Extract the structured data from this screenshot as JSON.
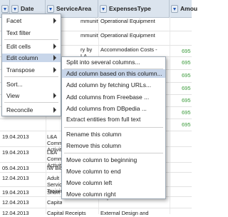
{
  "header": {
    "date": "Date",
    "service_area": "ServiceArea",
    "expenses_type": "ExpensesType",
    "amount": "Amou"
  },
  "rows": [
    {
      "date": "",
      "service": "mmunity",
      "expense": "Operational Equipment",
      "amount": ""
    },
    {
      "date": "",
      "service": "mmunity",
      "expense": "Operational Equipment",
      "amount": ""
    },
    {
      "date": "",
      "service": "ry by LA",
      "expense": "Accommodation Costs -",
      "amount": "695"
    },
    {
      "date": "",
      "service": "",
      "expense": "",
      "amount": "695"
    },
    {
      "date": "",
      "service": "",
      "expense": "",
      "amount": "695"
    },
    {
      "date": "",
      "service": "",
      "expense": "",
      "amount": "695"
    },
    {
      "date": "",
      "service": "",
      "expense": "",
      "amount": "695"
    },
    {
      "date": "",
      "service": "",
      "expense": "",
      "amount": "695"
    },
    {
      "date": "",
      "service": "",
      "expense": "",
      "amount": "695"
    },
    {
      "date": "19.04.2013",
      "service": "L&A Comm Activity",
      "expense": "",
      "amount": ""
    },
    {
      "date": "19.04.2013",
      "service": "L&A Comm Activity",
      "expense": "",
      "amount": ""
    },
    {
      "date": "05.04.2013",
      "service": "IW Biologica",
      "expense": "",
      "amount": ""
    },
    {
      "date": "12.04.2013",
      "service": "Adult Servic Training",
      "expense": "",
      "amount": ""
    },
    {
      "date": "19.04.2013",
      "service": "Short Break",
      "expense": "",
      "amount": ""
    },
    {
      "date": "12.04.2013",
      "service": "Capital Rec",
      "expense": "",
      "amount": ""
    },
    {
      "date": "12.04.2013",
      "service": "Capital Receipts",
      "expense": "External Design and",
      "amount": ""
    }
  ],
  "partial_texts": {
    "supervision": "Supervision Fees"
  },
  "main_menu": [
    {
      "label": "Facet",
      "submenu": true
    },
    {
      "label": "Text filter",
      "submenu": false
    },
    {
      "label": "Edit cells",
      "submenu": true
    },
    {
      "label": "Edit column",
      "submenu": true,
      "highlight": true
    },
    {
      "label": "Transpose",
      "submenu": true
    },
    {
      "label": "Sort...",
      "submenu": false
    },
    {
      "label": "View",
      "submenu": true
    },
    {
      "label": "Reconcile",
      "submenu": true
    }
  ],
  "sub_menu": [
    {
      "label": "Split into several columns..."
    },
    {
      "label": "Add column based on this column...",
      "highlight": true
    },
    {
      "label": "Add column by fetching URLs..."
    },
    {
      "label": "Add columns from Freebase ..."
    },
    {
      "label": "Add columns from DBpedia ..."
    },
    {
      "label": "Extract entities from full text"
    },
    {
      "label": "Rename this column"
    },
    {
      "label": "Remove this column"
    },
    {
      "label": "Move column to beginning"
    },
    {
      "label": "Move column to end"
    },
    {
      "label": "Move column left"
    },
    {
      "label": "Move column right"
    }
  ]
}
